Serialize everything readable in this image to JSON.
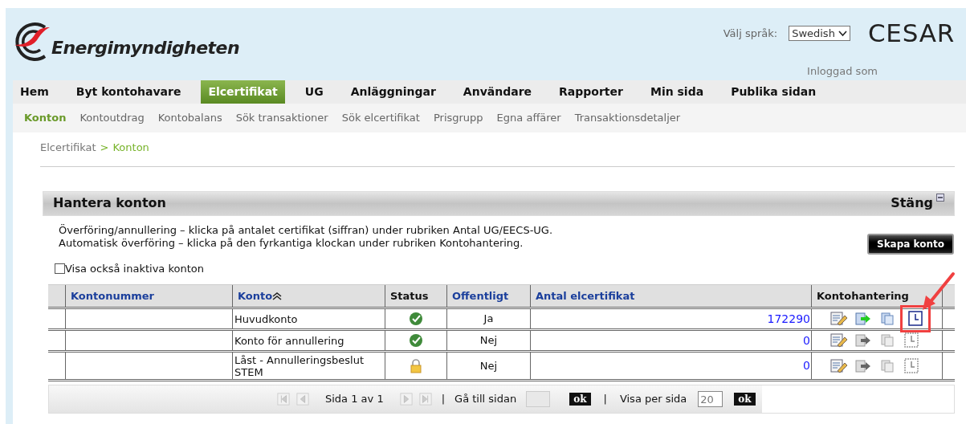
{
  "header": {
    "logo_text": "Energimyndigheten",
    "language_label": "Välj språk:",
    "language_value": "Swedish",
    "app_name": "CESAR",
    "logged_in_label": "Inloggad som"
  },
  "nav": [
    {
      "label": "Hem",
      "selected": false
    },
    {
      "label": "Byt kontohavare",
      "selected": false
    },
    {
      "label": "Elcertifikat",
      "selected": true
    },
    {
      "label": "UG",
      "selected": false
    },
    {
      "label": "Anläggningar",
      "selected": false
    },
    {
      "label": "Användare",
      "selected": false
    },
    {
      "label": "Rapporter",
      "selected": false
    },
    {
      "label": "Min sida",
      "selected": false
    },
    {
      "label": "Publika sidan",
      "selected": false
    }
  ],
  "subnav": [
    {
      "label": "Konton",
      "selected": true
    },
    {
      "label": "Kontoutdrag",
      "selected": false
    },
    {
      "label": "Kontobalans",
      "selected": false
    },
    {
      "label": "Sök transaktioner",
      "selected": false
    },
    {
      "label": "Sök elcertifikat",
      "selected": false
    },
    {
      "label": "Prisgrupp",
      "selected": false
    },
    {
      "label": "Egna affärer",
      "selected": false
    },
    {
      "label": "Transaktionsdetaljer",
      "selected": false
    }
  ],
  "breadcrumb": {
    "parent": "Elcertifikat",
    "separator": ">",
    "current": "Konton"
  },
  "panel": {
    "title": "Hantera konton",
    "close_label": "Stäng",
    "instructions": [
      "Överföring/annullering – klicka på antalet certifikat (siffran) under rubriken Antal UG/EECS-UG.",
      "Automatisk överföring – klicka på den fyrkantiga klockan under rubriken Kontohantering."
    ],
    "create_button": "Skapa konto",
    "show_inactive": {
      "label": "Visa också inaktiva konton",
      "checked": false
    }
  },
  "table": {
    "columns": [
      {
        "label": "Kontonummer",
        "sortable": true,
        "sorted_ascending": false
      },
      {
        "label": "Konto",
        "sortable": true,
        "sorted_ascending": true
      },
      {
        "label": "Status",
        "sortable": false,
        "sorted_ascending": false
      },
      {
        "label": "Offentligt",
        "sortable": true,
        "sorted_ascending": false
      },
      {
        "label": "Antal elcertifikat",
        "sortable": true,
        "sorted_ascending": false
      },
      {
        "label": "Kontohantering",
        "sortable": false,
        "sorted_ascending": false
      }
    ],
    "rows": [
      {
        "konto": "Huvudkonto",
        "locked": false,
        "offentligt": "Ja",
        "antal": "172290",
        "actions": [
          {
            "kind": "edit",
            "enabled": true,
            "highlighted": false
          },
          {
            "kind": "transfer",
            "enabled": true,
            "highlighted": false
          },
          {
            "kind": "copy",
            "enabled": true,
            "highlighted": false
          },
          {
            "kind": "clock",
            "enabled": true,
            "highlighted": true
          }
        ]
      },
      {
        "konto": "Konto för annullering",
        "locked": false,
        "offentligt": "Nej",
        "antal": "0",
        "actions": [
          {
            "kind": "edit",
            "enabled": true,
            "highlighted": false
          },
          {
            "kind": "transfer",
            "enabled": false,
            "highlighted": false
          },
          {
            "kind": "copy",
            "enabled": false,
            "highlighted": false
          },
          {
            "kind": "clock",
            "enabled": false,
            "highlighted": false
          }
        ]
      },
      {
        "konto": "Låst - Annulleringsbeslut STEM",
        "locked": true,
        "offentligt": "Nej",
        "antal": "0",
        "actions": [
          {
            "kind": "edit",
            "enabled": true,
            "highlighted": false
          },
          {
            "kind": "transfer",
            "enabled": false,
            "highlighted": false
          },
          {
            "kind": "copy",
            "enabled": false,
            "highlighted": false
          },
          {
            "kind": "clock",
            "enabled": false,
            "highlighted": false
          }
        ]
      }
    ]
  },
  "pager": {
    "page_text": "Sida 1 av 1",
    "separator_1": "|",
    "goto_label": "Gå till sidan",
    "goto_button": "ok",
    "separator_2": "|",
    "per_page_label": "Visa per sida",
    "per_page_value": "20",
    "per_page_button": "ok"
  }
}
